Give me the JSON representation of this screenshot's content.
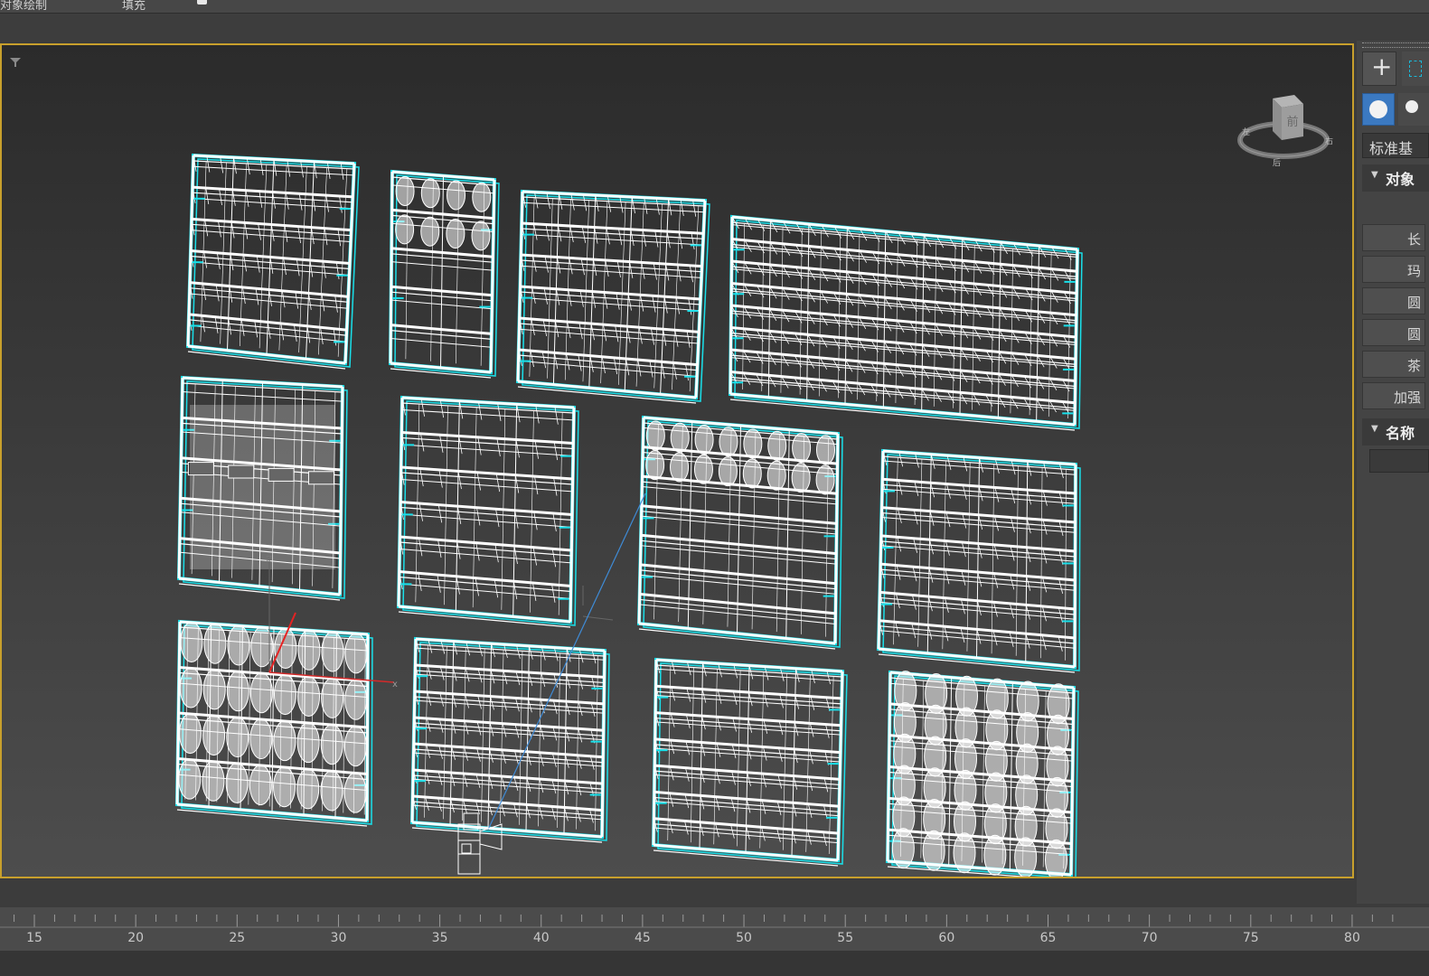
{
  "toolbar": {
    "left_label": "对象绘制",
    "mid_label": "填充"
  },
  "panel": {
    "create_icon": "+",
    "dropdown": "标准基",
    "rollout1_title": "对象",
    "rollout2_title": "名称",
    "buttons": [
      "长",
      "玛",
      "圆",
      "圆",
      "茶",
      "加强"
    ]
  },
  "viewcube": {
    "face_label": "前",
    "compass_left": "左",
    "compass_right": "右",
    "compass_bottom": "后"
  },
  "timeline": {
    "labels": [
      "15",
      "20",
      "25",
      "30",
      "35",
      "40",
      "45",
      "50",
      "55",
      "60",
      "65",
      "70",
      "75",
      "80"
    ]
  },
  "colors": {
    "selection_wire": "#19e0ea",
    "object_wire": "#ffffff",
    "viewport_border": "#c8a02c"
  }
}
